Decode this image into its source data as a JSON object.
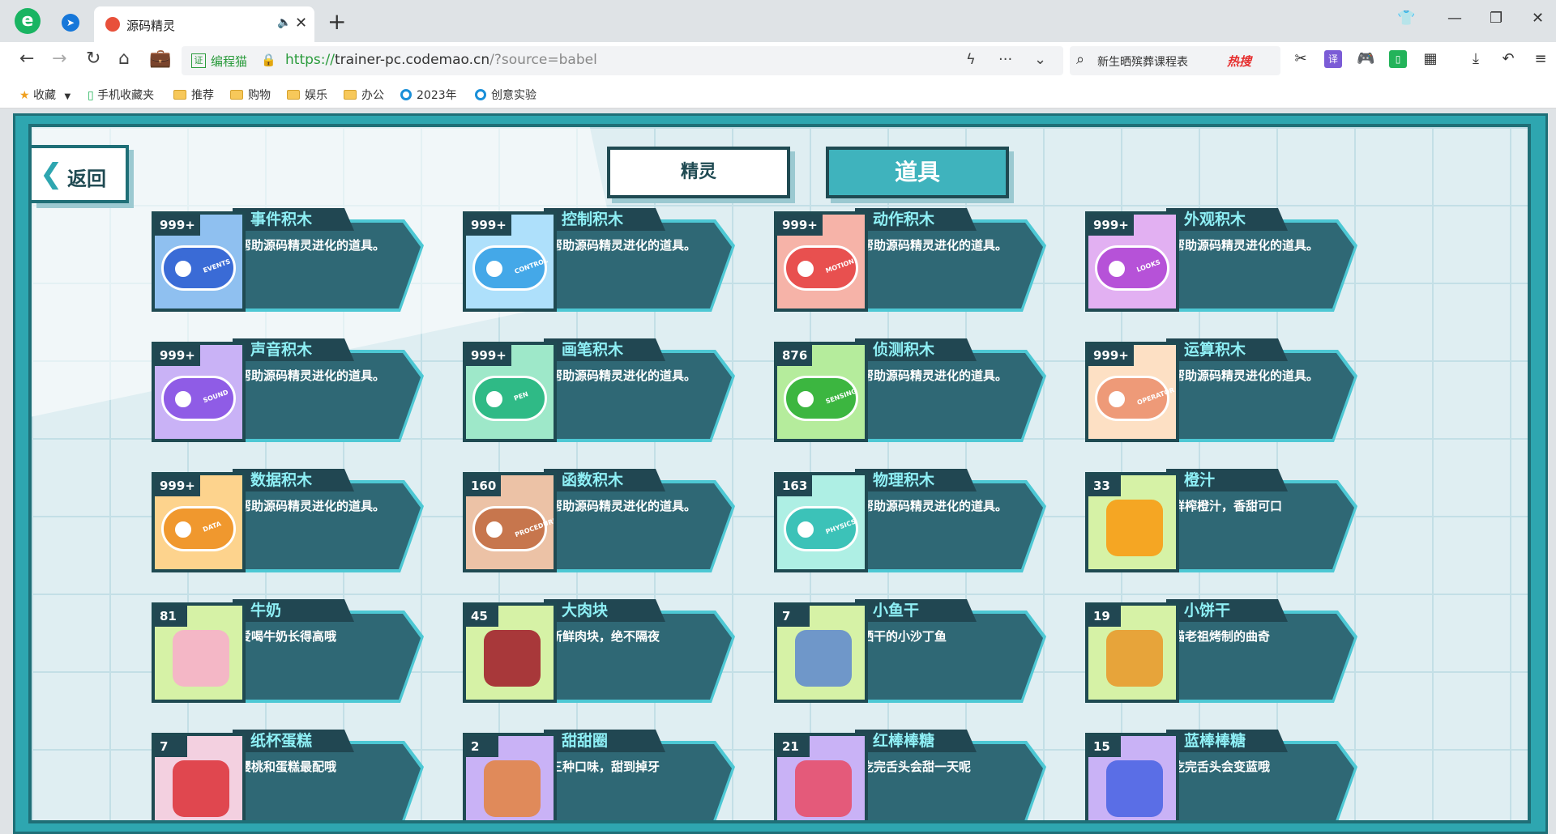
{
  "browser": {
    "tab_title": "源码精灵",
    "url_org": "编程猫",
    "url_scheme": "https://",
    "url_host": "trainer-pc.codemao.cn",
    "url_path": "/?source=babel",
    "search_text": "新生晒殡葬课程表",
    "search_hot": "热搜",
    "bookmarks": [
      "收藏",
      "手机收藏夹",
      "推荐",
      "购物",
      "娱乐",
      "办公",
      "2023年",
      "创意实验"
    ]
  },
  "game": {
    "back_label": "返回",
    "tabs": [
      "精灵",
      "道具"
    ],
    "items": [
      {
        "count": "999+",
        "name": "事件积木",
        "desc": "帮助源码精灵进化的道具。",
        "color": "#3a6bd6",
        "bg": "#8fc0f0",
        "kind": "key",
        "label": "EVENTS"
      },
      {
        "count": "999+",
        "name": "控制积木",
        "desc": "帮助源码精灵进化的道具。",
        "color": "#44a8e8",
        "bg": "#aee0fb",
        "kind": "key",
        "label": "CONTROL"
      },
      {
        "count": "999+",
        "name": "动作积木",
        "desc": "帮助源码精灵进化的道具。",
        "color": "#e8504f",
        "bg": "#f6b3a8",
        "kind": "key",
        "label": "MOTION"
      },
      {
        "count": "999+",
        "name": "外观积木",
        "desc": "帮助源码精灵进化的道具。",
        "color": "#b652d8",
        "bg": "#e2b0f2",
        "kind": "key",
        "label": "LOOKS"
      },
      {
        "count": "999+",
        "name": "声音积木",
        "desc": "帮助源码精灵进化的道具。",
        "color": "#8f5ce6",
        "bg": "#c9b2f6",
        "kind": "key",
        "label": "SOUND"
      },
      {
        "count": "999+",
        "name": "画笔积木",
        "desc": "帮助源码精灵进化的道具。",
        "color": "#2fba86",
        "bg": "#9ee8c9",
        "kind": "key",
        "label": "PEN"
      },
      {
        "count": "876",
        "name": "侦测积木",
        "desc": "帮助源码精灵进化的道具。",
        "color": "#3cb640",
        "bg": "#b5ec9c",
        "kind": "key",
        "label": "SENSING"
      },
      {
        "count": "999+",
        "name": "运算积木",
        "desc": "帮助源码精灵进化的道具。",
        "color": "#ee9a78",
        "bg": "#fde0c4",
        "kind": "key",
        "label": "OPERATOR"
      },
      {
        "count": "999+",
        "name": "数据积木",
        "desc": "帮助源码精灵进化的道具。",
        "color": "#f0982e",
        "bg": "#fdd38d",
        "kind": "key",
        "label": "DATA"
      },
      {
        "count": "160",
        "name": "函数积木",
        "desc": "帮助源码精灵进化的道具。",
        "color": "#c7764d",
        "bg": "#ecc2a6",
        "kind": "key",
        "label": "PROCEDURES"
      },
      {
        "count": "163",
        "name": "物理积木",
        "desc": "帮助源码精灵进化的道具。",
        "color": "#3cc2b8",
        "bg": "#aeefe4",
        "kind": "key",
        "label": "PHYSICS"
      },
      {
        "count": "33",
        "name": "橙汁",
        "desc": "鲜榨橙汁，香甜可口",
        "color": "#f5a623",
        "bg": "#d6f2a6",
        "kind": "food",
        "label": ""
      },
      {
        "count": "81",
        "name": "牛奶",
        "desc": "爱喝牛奶长得高哦",
        "color": "#f4b7c6",
        "bg": "#d6f2a6",
        "kind": "food",
        "label": ""
      },
      {
        "count": "45",
        "name": "大肉块",
        "desc": "新鲜肉块，绝不隔夜",
        "color": "#a8383a",
        "bg": "#d6f2a6",
        "kind": "food",
        "label": ""
      },
      {
        "count": "7",
        "name": "小鱼干",
        "desc": "晒干的小沙丁鱼",
        "color": "#6f97c9",
        "bg": "#d6f2a6",
        "kind": "food",
        "label": ""
      },
      {
        "count": "19",
        "name": "小饼干",
        "desc": "猫老祖烤制的曲奇",
        "color": "#e7a43a",
        "bg": "#d6f2a6",
        "kind": "food",
        "label": ""
      },
      {
        "count": "7",
        "name": "纸杯蛋糕",
        "desc": "樱桃和蛋糕最配哦",
        "color": "#e0474f",
        "bg": "#f3d0e0",
        "kind": "food",
        "label": ""
      },
      {
        "count": "2",
        "name": "甜甜圈",
        "desc": "三种口味，甜到掉牙",
        "color": "#e08a5a",
        "bg": "#c9b2f6",
        "kind": "food",
        "label": ""
      },
      {
        "count": "21",
        "name": "红棒棒糖",
        "desc": "吃完舌头会甜一天呢",
        "color": "#e45a7a",
        "bg": "#c9b2f6",
        "kind": "food",
        "label": ""
      },
      {
        "count": "15",
        "name": "蓝棒棒糖",
        "desc": "吃完舌头会变蓝哦",
        "color": "#5a6ee6",
        "bg": "#c9b2f6",
        "kind": "food",
        "label": ""
      }
    ]
  }
}
